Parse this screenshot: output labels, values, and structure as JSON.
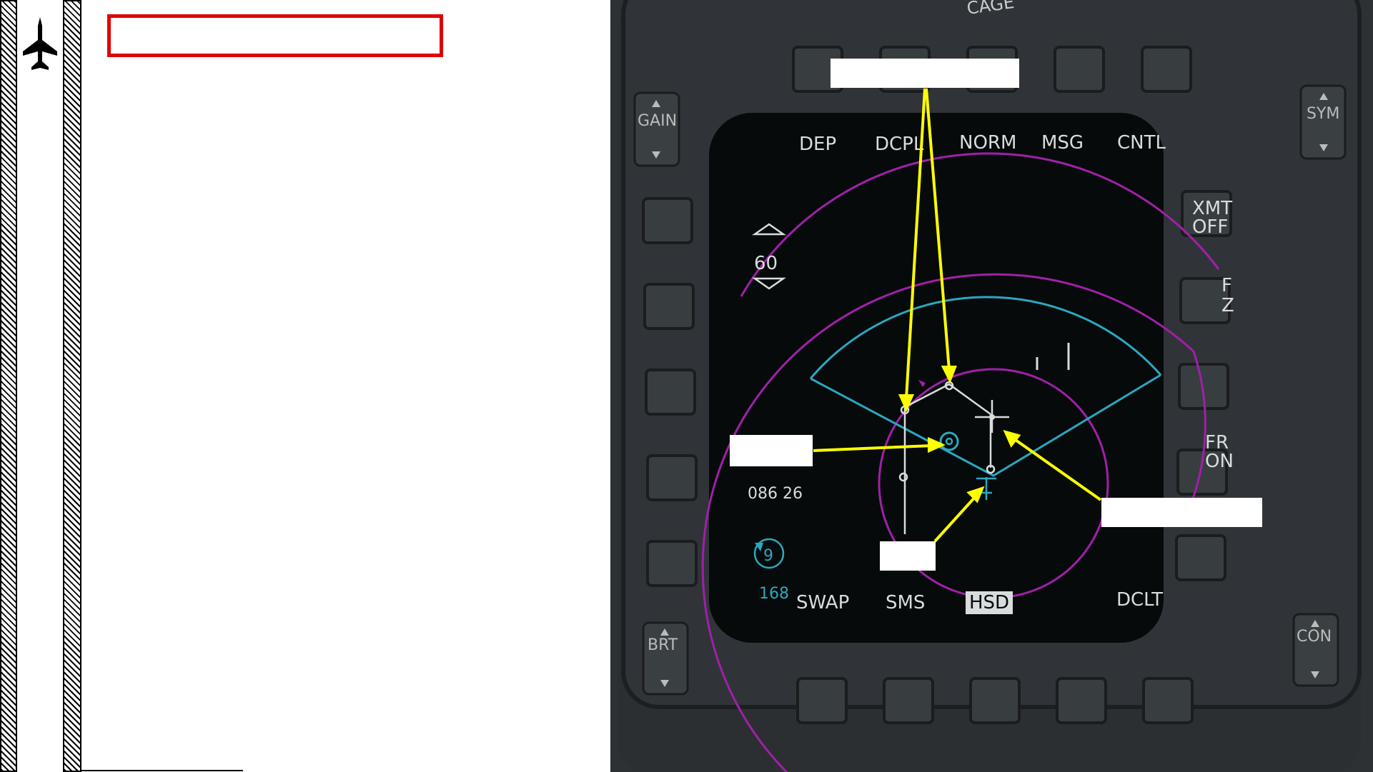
{
  "page": {
    "title_text": "",
    "background": "#ffffff",
    "frame_color": "#e00000"
  },
  "mfd": {
    "top_buttons": [
      "DEP",
      "DCPL",
      "NORM",
      "MSG",
      "CNTL"
    ],
    "bottom_buttons": [
      "SWAP",
      "SMS",
      "HSD",
      "DCLT"
    ],
    "bottom_selected": "HSD",
    "right_labels": {
      "xmt_1": "XMT",
      "xmt_2": "OFF",
      "fz_1": "F",
      "fz_2": "Z",
      "fr_1": "FR",
      "fr_2": "ON"
    },
    "range_value": "60",
    "bullseye_readout": "086 26",
    "steerpoint_number": "9",
    "steerpoint_distance": "168",
    "rockers": {
      "gain": "GAIN",
      "sym": "SYM",
      "brt": "BRT",
      "con": "CON"
    },
    "bezel_text": "CAGE"
  },
  "colors": {
    "magenta": "#a020a8",
    "cyan": "#2aa8c0",
    "annotation": "#ffff00",
    "mfd_text": "#d8dcdc"
  },
  "icons": {
    "aircraft": "jet-silhouette-icon",
    "steerpoint": "steerpoint-circle-icon",
    "bullseye": "bullseye-icon",
    "ownship": "ownship-icon"
  }
}
